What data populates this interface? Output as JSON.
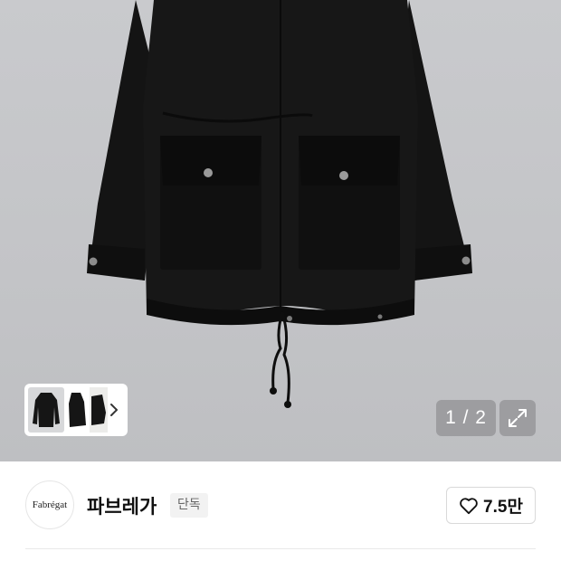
{
  "gallery": {
    "current_page": "1",
    "total_pages": "2",
    "counter_text": "1 / 2",
    "thumbnail_count": 3,
    "thumbnail_icons": [
      "parka-black-front",
      "parka-black-side",
      "parka-black-detail"
    ],
    "next_icon": "chevron-right-icon",
    "expand_icon": "expand-icon"
  },
  "brand": {
    "logo_text": "Fabrégat",
    "name": "파브레가",
    "badge": "단독"
  },
  "like": {
    "icon": "heart-outline-icon",
    "count": "7.5만"
  },
  "colors": {
    "background": "#c4c5c8",
    "jacket": "#131313",
    "overlay": "#96969a",
    "divider": "#e9e9e9"
  }
}
